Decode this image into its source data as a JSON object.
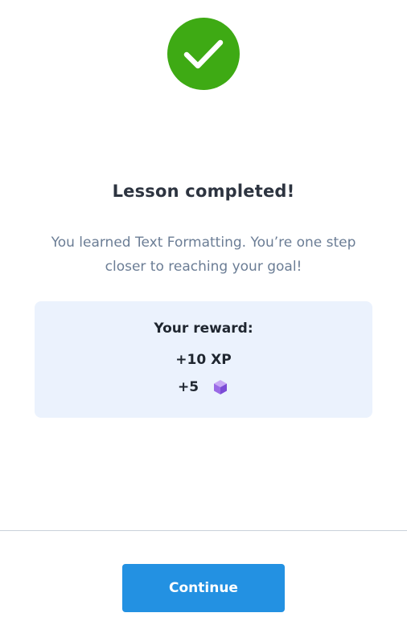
{
  "status_icon": {
    "name": "check-icon",
    "color": "#3eaa14"
  },
  "title": "Lesson completed!",
  "subtitle": "You learned Text Formatting. You’re one step closer to reaching your goal!",
  "reward": {
    "heading": "Your reward:",
    "xp": "+10 XP",
    "bits_amount": "+5",
    "bits_icon": "purple-cube-icon"
  },
  "actions": {
    "continue_label": "Continue",
    "continue_color": "#2391e2"
  }
}
